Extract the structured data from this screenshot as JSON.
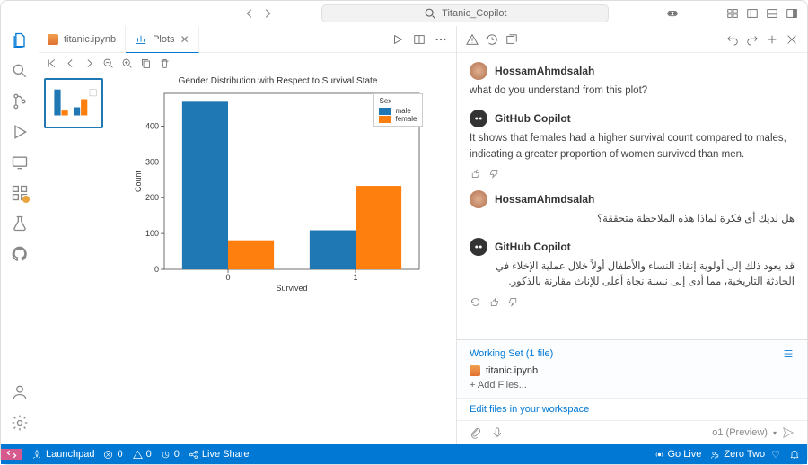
{
  "titlebar": {
    "project": "Titanic_Copilot"
  },
  "tabs": {
    "items": [
      {
        "label": "titanic.ipynb"
      },
      {
        "label": "Plots"
      }
    ]
  },
  "copilot": {
    "user_name": "HossamAhmdsalah",
    "bot_name": "GitHub Copilot",
    "messages": [
      {
        "text": "what do you understand from this plot?"
      },
      {
        "text": "It shows that females had a higher survival count compared to males, indicating a greater proportion of women survived than men."
      },
      {
        "text": "هل لديك أي فكرة لماذا هذه الملاحظة متحققة؟"
      },
      {
        "text": "قد يعود ذلك إلى أولوية إنقاذ النساء والأطفال أولاً خلال عملية الإخلاء في الحادثة التاريخية، مما أدى إلى نسبة نجاة أعلى للإناث مقارنة بالذكور."
      }
    ],
    "working_set_label": "Working Set (1 file)",
    "working_file": "titanic.ipynb",
    "add_files": "+ Add Files...",
    "edit_prompt": "Edit files in your workspace",
    "model": "o1 (Preview)"
  },
  "statusbar": {
    "launchpad": "Launchpad",
    "errors": "0",
    "warnings": "0",
    "ports": "0",
    "liveshare": "Live Share",
    "golive": "Go Live",
    "zerotwo": "Zero Two"
  },
  "chart_data": {
    "type": "bar",
    "title": "Gender Distribution with Respect to Survival State",
    "xlabel": "Survived",
    "ylabel": "Count",
    "legend_title": "Sex",
    "categories": [
      "0",
      "1"
    ],
    "series": [
      {
        "name": "male",
        "values": [
          468,
          109
        ],
        "color": "#1f77b4"
      },
      {
        "name": "female",
        "values": [
          81,
          233
        ],
        "color": "#ff7f0e"
      }
    ],
    "yticks": [
      0,
      100,
      200,
      300,
      400
    ]
  }
}
